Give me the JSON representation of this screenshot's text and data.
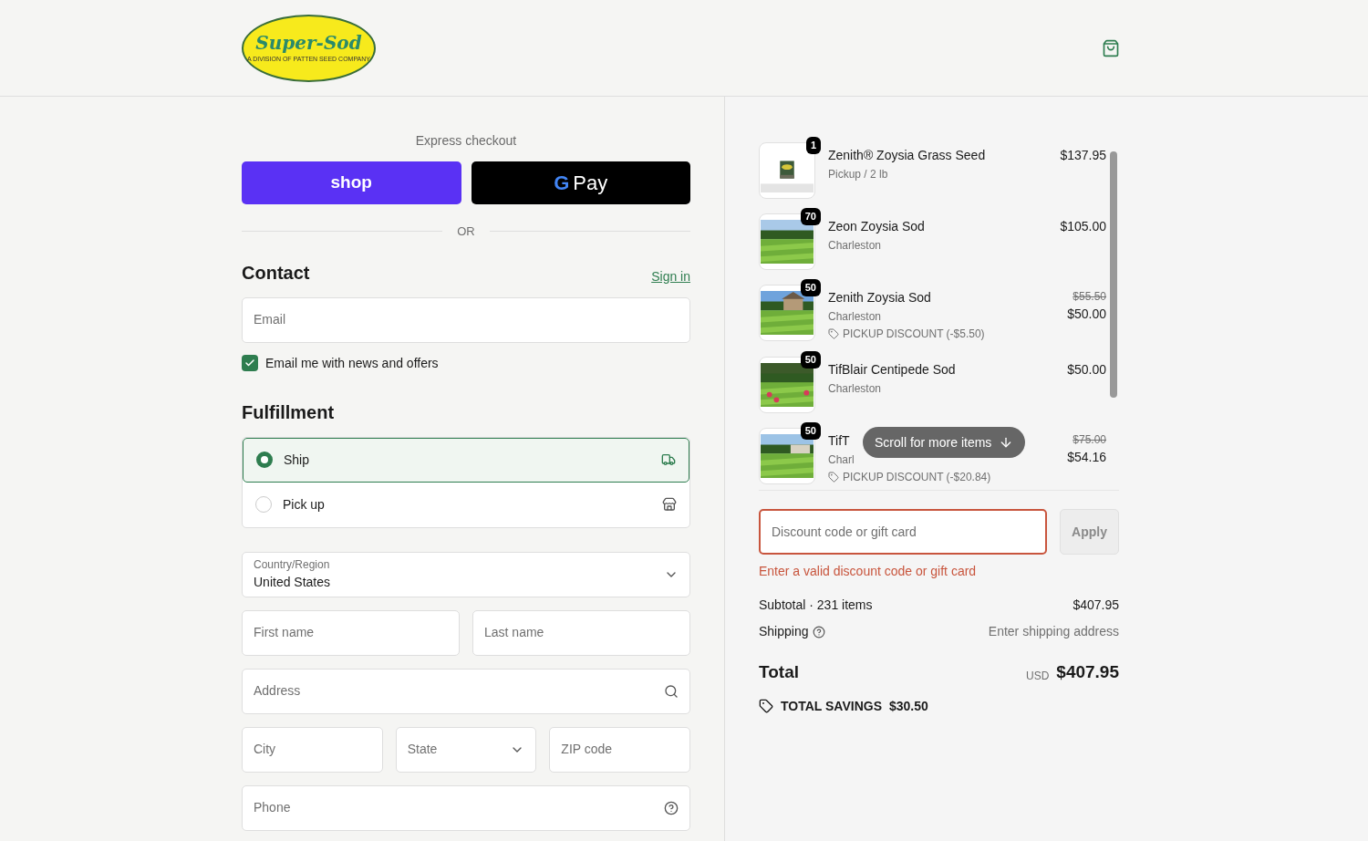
{
  "logo": {
    "name": "Super-Sod",
    "tagline": "A DIVISION OF PATTEN SEED COMPANY"
  },
  "express": {
    "title": "Express checkout",
    "buttons": [
      {
        "kind": "shop",
        "label": "shop"
      },
      {
        "kind": "gpay",
        "label": "Pay",
        "mark": "G"
      }
    ],
    "divider": "OR"
  },
  "contact": {
    "title": "Contact",
    "link": "Sign in",
    "email_placeholder": "Email",
    "newsletter": {
      "label": "Email me with news and offers",
      "checked": true
    }
  },
  "fulfillment": {
    "title": "Fulfillment",
    "options": [
      {
        "kind": "ship",
        "label": "Ship",
        "selected": true
      },
      {
        "kind": "pickup",
        "label": "Pick up",
        "selected": false
      }
    ]
  },
  "address": {
    "country_label": "Country/Region",
    "country": "United States",
    "first_name": "First name",
    "last_name": "Last name",
    "address": "Address",
    "city": "City",
    "state": "State",
    "zip": "ZIP code",
    "phone": "Phone"
  },
  "cart": {
    "items": [
      {
        "qty": "1",
        "name": "Zenith® Zoysia Grass Seed",
        "detail": "Pickup / 2 lb",
        "price": "$137.95"
      },
      {
        "qty": "70",
        "name": "Zeon Zoysia Sod",
        "detail": "Charleston",
        "price": "$105.00"
      },
      {
        "qty": "50",
        "name": "Zenith Zoysia Sod",
        "detail": "Charleston",
        "discount": "PICKUP DISCOUNT (-$5.50)",
        "old_price": "$55.50",
        "price": "$50.00"
      },
      {
        "qty": "50",
        "name": "TifBlair Centipede Sod",
        "detail": "Charleston",
        "price": "$50.00"
      },
      {
        "qty": "50",
        "name": "TifT",
        "detail": "Charl",
        "discount": "PICKUP DISCOUNT (-$20.84)",
        "old_price": "$75.00",
        "price": "$54.16"
      }
    ],
    "scroll_hint": "Scroll for more items",
    "discount_placeholder": "Discount code or gift card",
    "apply": "Apply",
    "error": "Enter a valid discount code or gift card",
    "subtotal_label": "Subtotal · 231 items",
    "subtotal": "$407.95",
    "shipping_label": "Shipping",
    "shipping": "Enter shipping address",
    "total_label": "Total",
    "currency": "USD",
    "total": "$407.95",
    "savings_label": "TOTAL SAVINGS",
    "savings": "$30.50"
  }
}
